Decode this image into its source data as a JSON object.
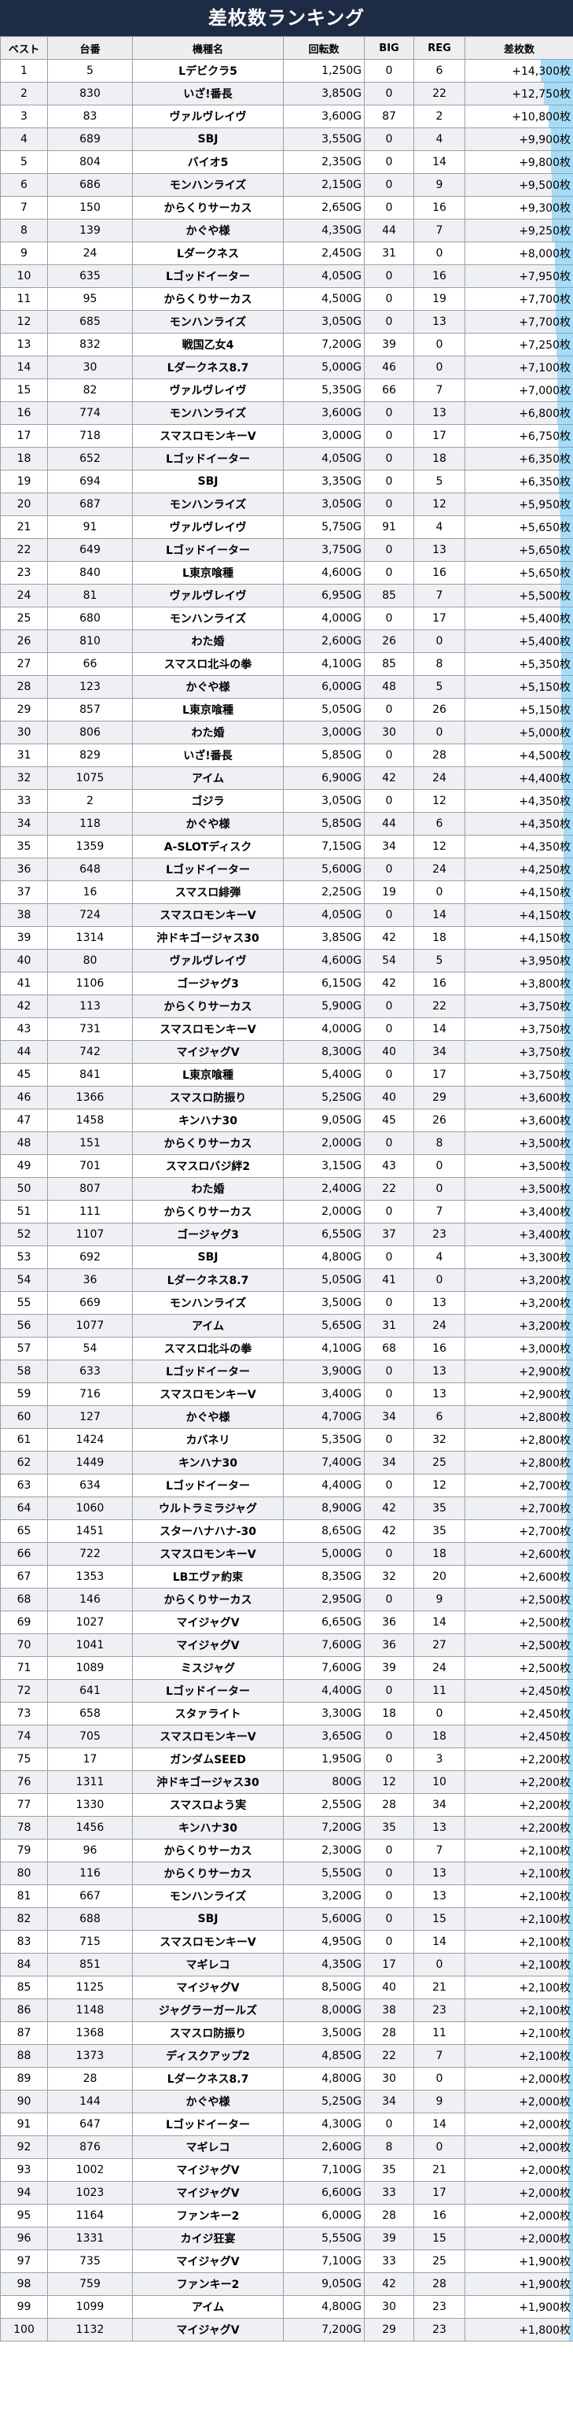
{
  "title": "差枚数ランキング",
  "colors": {
    "header_bg": "#1e2b45",
    "value_text": "#1a56c9",
    "bar": "#a6dcf7"
  },
  "headers": [
    "ベスト",
    "台番",
    "機種名",
    "回転数",
    "BIG",
    "REG",
    "差枚数"
  ],
  "rows": [
    [
      "1",
      "5",
      "Lデビクラ5",
      "1,250G",
      "0",
      "6",
      "+14,300枚"
    ],
    [
      "2",
      "830",
      "いざ!番長",
      "3,850G",
      "0",
      "22",
      "+12,750枚"
    ],
    [
      "3",
      "83",
      "ヴァルヴレイヴ",
      "3,600G",
      "87",
      "2",
      "+10,800枚"
    ],
    [
      "4",
      "689",
      "SBJ",
      "3,550G",
      "0",
      "4",
      "+9,900枚"
    ],
    [
      "5",
      "804",
      "バイオ5",
      "2,350G",
      "0",
      "14",
      "+9,800枚"
    ],
    [
      "6",
      "686",
      "モンハンライズ",
      "2,150G",
      "0",
      "9",
      "+9,500枚"
    ],
    [
      "7",
      "150",
      "からくりサーカス",
      "2,650G",
      "0",
      "16",
      "+9,300枚"
    ],
    [
      "8",
      "139",
      "かぐや様",
      "4,350G",
      "44",
      "7",
      "+9,250枚"
    ],
    [
      "9",
      "24",
      "Lダークネス",
      "2,450G",
      "31",
      "0",
      "+8,000枚"
    ],
    [
      "10",
      "635",
      "Lゴッドイーター",
      "4,050G",
      "0",
      "16",
      "+7,950枚"
    ],
    [
      "11",
      "95",
      "からくりサーカス",
      "4,500G",
      "0",
      "19",
      "+7,700枚"
    ],
    [
      "12",
      "685",
      "モンハンライズ",
      "3,050G",
      "0",
      "13",
      "+7,700枚"
    ],
    [
      "13",
      "832",
      "戦国乙女4",
      "7,200G",
      "39",
      "0",
      "+7,250枚"
    ],
    [
      "14",
      "30",
      "Lダークネス8.7",
      "5,000G",
      "46",
      "0",
      "+7,100枚"
    ],
    [
      "15",
      "82",
      "ヴァルヴレイヴ",
      "5,350G",
      "66",
      "7",
      "+7,000枚"
    ],
    [
      "16",
      "774",
      "モンハンライズ",
      "3,600G",
      "0",
      "13",
      "+6,800枚"
    ],
    [
      "17",
      "718",
      "スマスロモンキーV",
      "3,000G",
      "0",
      "17",
      "+6,750枚"
    ],
    [
      "18",
      "652",
      "Lゴッドイーター",
      "4,050G",
      "0",
      "18",
      "+6,350枚"
    ],
    [
      "19",
      "694",
      "SBJ",
      "3,350G",
      "0",
      "5",
      "+6,350枚"
    ],
    [
      "20",
      "687",
      "モンハンライズ",
      "3,050G",
      "0",
      "12",
      "+5,950枚"
    ],
    [
      "21",
      "91",
      "ヴァルヴレイヴ",
      "5,750G",
      "91",
      "4",
      "+5,650枚"
    ],
    [
      "22",
      "649",
      "Lゴッドイーター",
      "3,750G",
      "0",
      "13",
      "+5,650枚"
    ],
    [
      "23",
      "840",
      "L東京喰種",
      "4,600G",
      "0",
      "16",
      "+5,650枚"
    ],
    [
      "24",
      "81",
      "ヴァルヴレイヴ",
      "6,950G",
      "85",
      "7",
      "+5,500枚"
    ],
    [
      "25",
      "680",
      "モンハンライズ",
      "4,000G",
      "0",
      "17",
      "+5,400枚"
    ],
    [
      "26",
      "810",
      "わた婚",
      "2,600G",
      "26",
      "0",
      "+5,400枚"
    ],
    [
      "27",
      "66",
      "スマスロ北斗の拳",
      "4,100G",
      "85",
      "8",
      "+5,350枚"
    ],
    [
      "28",
      "123",
      "かぐや様",
      "6,000G",
      "48",
      "5",
      "+5,150枚"
    ],
    [
      "29",
      "857",
      "L東京喰種",
      "5,050G",
      "0",
      "26",
      "+5,150枚"
    ],
    [
      "30",
      "806",
      "わた婚",
      "3,000G",
      "30",
      "0",
      "+5,000枚"
    ],
    [
      "31",
      "829",
      "いざ!番長",
      "5,850G",
      "0",
      "28",
      "+4,500枚"
    ],
    [
      "32",
      "1075",
      "アイム",
      "6,900G",
      "42",
      "24",
      "+4,400枚"
    ],
    [
      "33",
      "2",
      "ゴジラ",
      "3,050G",
      "0",
      "12",
      "+4,350枚"
    ],
    [
      "34",
      "118",
      "かぐや様",
      "5,850G",
      "44",
      "6",
      "+4,350枚"
    ],
    [
      "35",
      "1359",
      "A-SLOTディスク",
      "7,150G",
      "34",
      "12",
      "+4,350枚"
    ],
    [
      "36",
      "648",
      "Lゴッドイーター",
      "5,600G",
      "0",
      "24",
      "+4,250枚"
    ],
    [
      "37",
      "16",
      "スマスロ緋弾",
      "2,250G",
      "19",
      "0",
      "+4,150枚"
    ],
    [
      "38",
      "724",
      "スマスロモンキーV",
      "4,050G",
      "0",
      "14",
      "+4,150枚"
    ],
    [
      "39",
      "1314",
      "沖ドキゴージャス30",
      "3,850G",
      "42",
      "18",
      "+4,150枚"
    ],
    [
      "40",
      "80",
      "ヴァルヴレイヴ",
      "4,600G",
      "54",
      "5",
      "+3,950枚"
    ],
    [
      "41",
      "1106",
      "ゴージャグ3",
      "6,150G",
      "42",
      "16",
      "+3,800枚"
    ],
    [
      "42",
      "113",
      "からくりサーカス",
      "5,900G",
      "0",
      "22",
      "+3,750枚"
    ],
    [
      "43",
      "731",
      "スマスロモンキーV",
      "4,000G",
      "0",
      "14",
      "+3,750枚"
    ],
    [
      "44",
      "742",
      "マイジャグV",
      "8,300G",
      "40",
      "34",
      "+3,750枚"
    ],
    [
      "45",
      "841",
      "L東京喰種",
      "5,400G",
      "0",
      "17",
      "+3,750枚"
    ],
    [
      "46",
      "1366",
      "スマスロ防振り",
      "5,250G",
      "40",
      "29",
      "+3,600枚"
    ],
    [
      "47",
      "1458",
      "キンハナ30",
      "9,050G",
      "45",
      "26",
      "+3,600枚"
    ],
    [
      "48",
      "151",
      "からくりサーカス",
      "2,000G",
      "0",
      "8",
      "+3,500枚"
    ],
    [
      "49",
      "701",
      "スマスロバジ絆2",
      "3,150G",
      "43",
      "0",
      "+3,500枚"
    ],
    [
      "50",
      "807",
      "わた婚",
      "2,400G",
      "22",
      "0",
      "+3,500枚"
    ],
    [
      "51",
      "111",
      "からくりサーカス",
      "2,000G",
      "0",
      "7",
      "+3,400枚"
    ],
    [
      "52",
      "1107",
      "ゴージャグ3",
      "6,550G",
      "37",
      "23",
      "+3,400枚"
    ],
    [
      "53",
      "692",
      "SBJ",
      "4,800G",
      "0",
      "4",
      "+3,300枚"
    ],
    [
      "54",
      "36",
      "Lダークネス8.7",
      "5,050G",
      "41",
      "0",
      "+3,200枚"
    ],
    [
      "55",
      "669",
      "モンハンライズ",
      "3,500G",
      "0",
      "13",
      "+3,200枚"
    ],
    [
      "56",
      "1077",
      "アイム",
      "5,650G",
      "31",
      "24",
      "+3,200枚"
    ],
    [
      "57",
      "54",
      "スマスロ北斗の拳",
      "4,100G",
      "68",
      "16",
      "+3,000枚"
    ],
    [
      "58",
      "633",
      "Lゴッドイーター",
      "3,900G",
      "0",
      "13",
      "+2,900枚"
    ],
    [
      "59",
      "716",
      "スマスロモンキーV",
      "3,400G",
      "0",
      "13",
      "+2,900枚"
    ],
    [
      "60",
      "127",
      "かぐや様",
      "4,700G",
      "34",
      "6",
      "+2,800枚"
    ],
    [
      "61",
      "1424",
      "カバネリ",
      "5,350G",
      "0",
      "32",
      "+2,800枚"
    ],
    [
      "62",
      "1449",
      "キンハナ30",
      "7,400G",
      "34",
      "25",
      "+2,800枚"
    ],
    [
      "63",
      "634",
      "Lゴッドイーター",
      "4,400G",
      "0",
      "12",
      "+2,700枚"
    ],
    [
      "64",
      "1060",
      "ウルトラミラジャグ",
      "8,900G",
      "42",
      "35",
      "+2,700枚"
    ],
    [
      "65",
      "1451",
      "スターハナハナ-30",
      "8,650G",
      "42",
      "35",
      "+2,700枚"
    ],
    [
      "66",
      "722",
      "スマスロモンキーV",
      "5,000G",
      "0",
      "18",
      "+2,600枚"
    ],
    [
      "67",
      "1353",
      "LBエヴァ約束",
      "8,350G",
      "32",
      "20",
      "+2,600枚"
    ],
    [
      "68",
      "146",
      "からくりサーカス",
      "2,950G",
      "0",
      "9",
      "+2,500枚"
    ],
    [
      "69",
      "1027",
      "マイジャグV",
      "6,650G",
      "36",
      "14",
      "+2,500枚"
    ],
    [
      "70",
      "1041",
      "マイジャグV",
      "7,600G",
      "36",
      "27",
      "+2,500枚"
    ],
    [
      "71",
      "1089",
      "ミスジャグ",
      "7,600G",
      "39",
      "24",
      "+2,500枚"
    ],
    [
      "72",
      "641",
      "Lゴッドイーター",
      "4,400G",
      "0",
      "11",
      "+2,450枚"
    ],
    [
      "73",
      "658",
      "スタァライト",
      "3,300G",
      "18",
      "0",
      "+2,450枚"
    ],
    [
      "74",
      "705",
      "スマスロモンキーV",
      "3,650G",
      "0",
      "18",
      "+2,450枚"
    ],
    [
      "75",
      "17",
      "ガンダムSEED",
      "1,950G",
      "0",
      "3",
      "+2,200枚"
    ],
    [
      "76",
      "1311",
      "沖ドキゴージャス30",
      "800G",
      "12",
      "10",
      "+2,200枚"
    ],
    [
      "77",
      "1330",
      "スマスロよう実",
      "2,550G",
      "28",
      "34",
      "+2,200枚"
    ],
    [
      "78",
      "1456",
      "キンハナ30",
      "7,200G",
      "35",
      "13",
      "+2,200枚"
    ],
    [
      "79",
      "96",
      "からくりサーカス",
      "2,300G",
      "0",
      "7",
      "+2,100枚"
    ],
    [
      "80",
      "116",
      "からくりサーカス",
      "5,550G",
      "0",
      "13",
      "+2,100枚"
    ],
    [
      "81",
      "667",
      "モンハンライズ",
      "3,200G",
      "0",
      "13",
      "+2,100枚"
    ],
    [
      "82",
      "688",
      "SBJ",
      "5,600G",
      "0",
      "15",
      "+2,100枚"
    ],
    [
      "83",
      "715",
      "スマスロモンキーV",
      "4,950G",
      "0",
      "14",
      "+2,100枚"
    ],
    [
      "84",
      "851",
      "マギレコ",
      "4,350G",
      "17",
      "0",
      "+2,100枚"
    ],
    [
      "85",
      "1125",
      "マイジャグV",
      "8,500G",
      "40",
      "21",
      "+2,100枚"
    ],
    [
      "86",
      "1148",
      "ジャグラーガールズ",
      "8,000G",
      "38",
      "23",
      "+2,100枚"
    ],
    [
      "87",
      "1368",
      "スマスロ防振り",
      "3,500G",
      "28",
      "11",
      "+2,100枚"
    ],
    [
      "88",
      "1373",
      "ディスクアップ2",
      "4,850G",
      "22",
      "7",
      "+2,100枚"
    ],
    [
      "89",
      "28",
      "Lダークネス8.7",
      "4,800G",
      "30",
      "0",
      "+2,000枚"
    ],
    [
      "90",
      "144",
      "かぐや様",
      "5,250G",
      "34",
      "9",
      "+2,000枚"
    ],
    [
      "91",
      "647",
      "Lゴッドイーター",
      "4,300G",
      "0",
      "14",
      "+2,000枚"
    ],
    [
      "92",
      "876",
      "マギレコ",
      "2,600G",
      "8",
      "0",
      "+2,000枚"
    ],
    [
      "93",
      "1002",
      "マイジャグV",
      "7,100G",
      "35",
      "21",
      "+2,000枚"
    ],
    [
      "94",
      "1023",
      "マイジャグV",
      "6,600G",
      "33",
      "17",
      "+2,000枚"
    ],
    [
      "95",
      "1164",
      "ファンキー2",
      "6,000G",
      "28",
      "16",
      "+2,000枚"
    ],
    [
      "96",
      "1331",
      "カイジ狂宴",
      "5,550G",
      "39",
      "15",
      "+2,000枚"
    ],
    [
      "97",
      "735",
      "マイジャグV",
      "7,100G",
      "33",
      "25",
      "+1,900枚"
    ],
    [
      "98",
      "759",
      "ファンキー2",
      "9,050G",
      "42",
      "28",
      "+1,900枚"
    ],
    [
      "99",
      "1099",
      "アイム",
      "4,800G",
      "30",
      "23",
      "+1,900枚"
    ],
    [
      "100",
      "1132",
      "マイジャグV",
      "7,200G",
      "29",
      "23",
      "+1,800枚"
    ]
  ]
}
